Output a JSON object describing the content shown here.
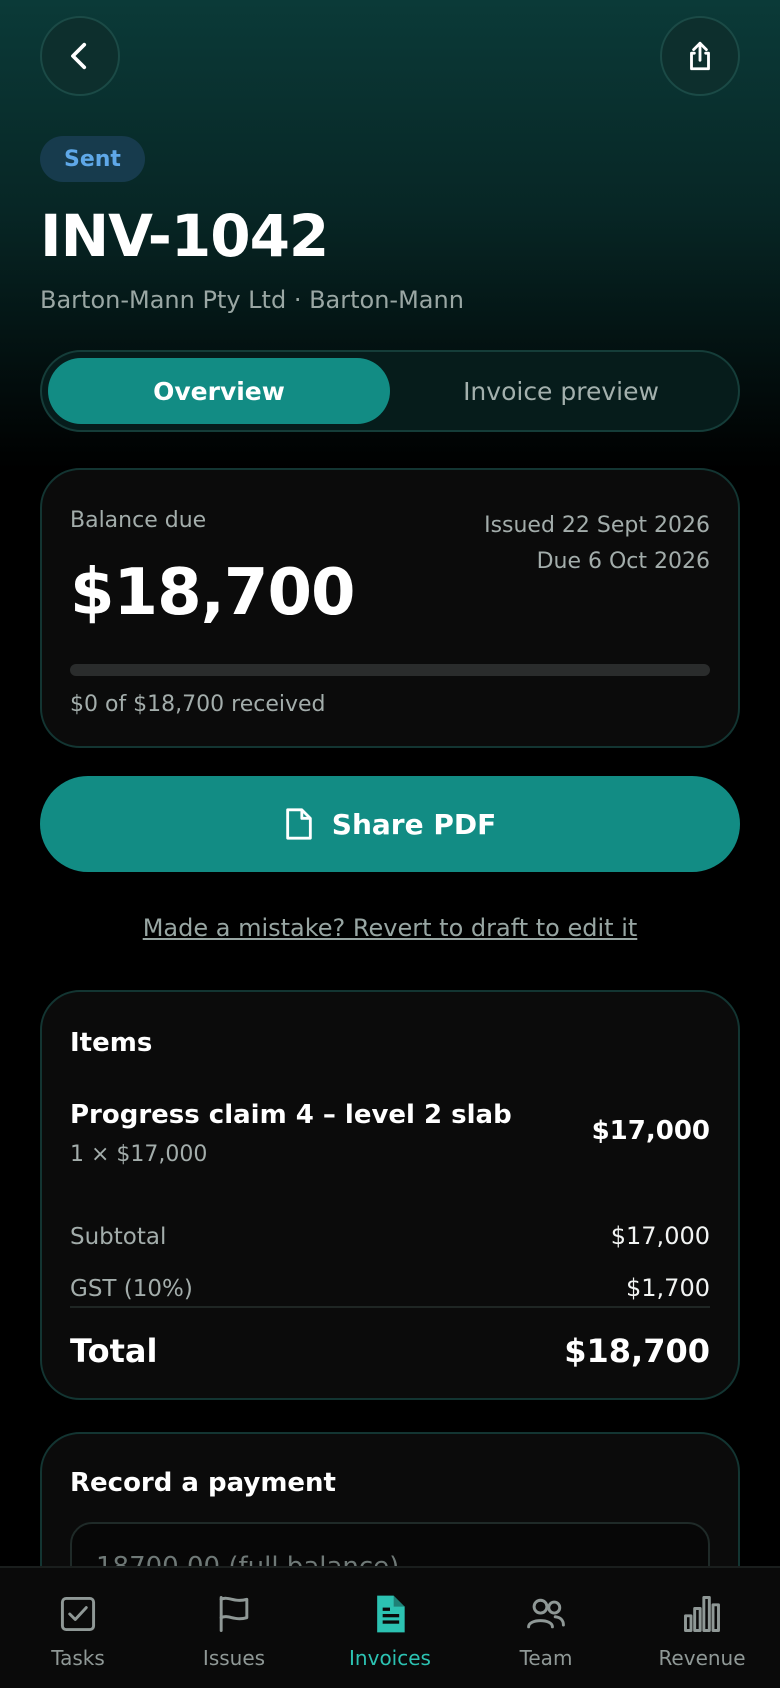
{
  "header": {
    "status": "Sent",
    "invoice_number": "INV-1042",
    "client": "Barton-Mann Pty Ltd · Barton-Mann"
  },
  "tabs": [
    {
      "label": "Overview",
      "active": true
    },
    {
      "label": "Invoice preview",
      "active": false
    }
  ],
  "balance": {
    "label": "Balance due",
    "amount": "$18,700",
    "issued": "Issued 22 Sept 2026",
    "due": "Due 6 Oct 2026",
    "progress_fraction": 0,
    "received_text": "$0 of $18,700 received"
  },
  "actions": {
    "share_label": "Share PDF",
    "revert_link": "Made a mistake? Revert to draft to edit it"
  },
  "items": {
    "title": "Items",
    "list": [
      {
        "name": "Progress claim 4 – level 2 slab",
        "qty": "1 × $17,000",
        "amount": "$17,000"
      }
    ],
    "subtotal_label": "Subtotal",
    "subtotal": "$17,000",
    "gst_label": "GST (10%)",
    "gst": "$1,700",
    "total_label": "Total",
    "total": "$18,700"
  },
  "payment": {
    "title": "Record a payment",
    "placeholder": "18700.00 (full balance)"
  },
  "nav": [
    {
      "label": "Tasks",
      "icon": "checkbox-icon",
      "active": false
    },
    {
      "label": "Issues",
      "icon": "flag-icon",
      "active": false
    },
    {
      "label": "Invoices",
      "icon": "document-icon",
      "active": true
    },
    {
      "label": "Team",
      "icon": "people-icon",
      "active": false
    },
    {
      "label": "Revenue",
      "icon": "bar-chart-icon",
      "active": false
    }
  ],
  "colors": {
    "accent": "#128c84",
    "accent_text": "#2cc2b2",
    "status_badge_bg": "#173b4d",
    "status_badge_text": "#5fa8e8"
  }
}
